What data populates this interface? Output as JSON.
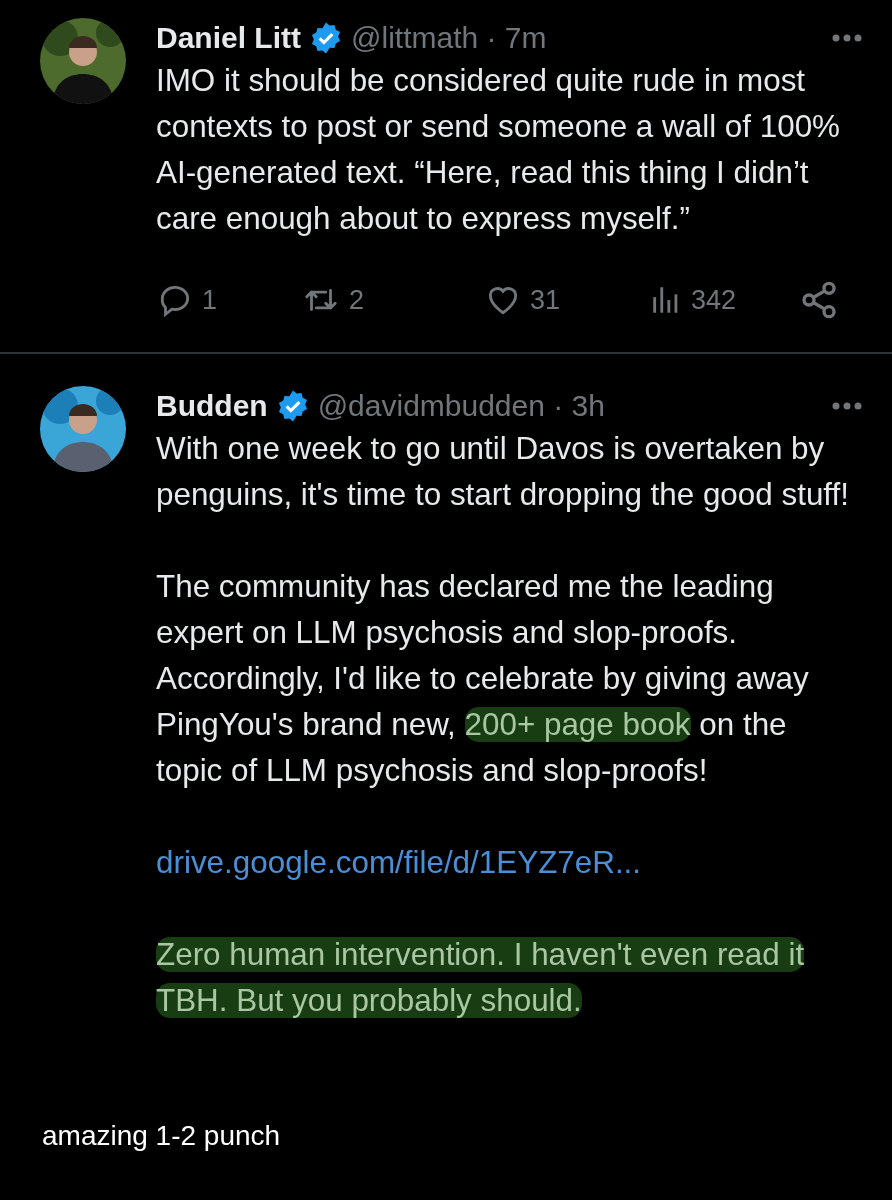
{
  "tweets": [
    {
      "author": "Daniel Litt",
      "verified": true,
      "meta": "@littmath · 7m",
      "body": [
        [
          {
            "kind": "text",
            "text": "IMO it should be considered quite rude in most contexts to post or send someone a wall of 100% AI-generated text. “Here, read this thing I didn’t care enough about to express myself.”"
          }
        ]
      ],
      "actions": [
        {
          "kind": "reply",
          "count": "1"
        },
        {
          "kind": "repost",
          "count": "2"
        },
        {
          "kind": "like",
          "count": "31"
        },
        {
          "kind": "views",
          "count": "342"
        },
        {
          "kind": "share"
        }
      ]
    },
    {
      "author": "Budden",
      "verified": true,
      "meta": "@davidmbudden · 3h",
      "body": [
        [
          {
            "kind": "text",
            "text": "With one week to go until Davos is overtaken by penguins, it's time to start dropping the good stuff!"
          }
        ],
        [
          {
            "kind": "text",
            "text": "The community has declared me the leading expert on LLM psychosis and slop-proofs. Accordingly, I'd like to celebrate by giving away PingYou's brand new, "
          },
          {
            "kind": "highlight",
            "text": "200+ page book"
          },
          {
            "kind": "text",
            "text": " on the topic of LLM psychosis and slop-proofs!"
          }
        ],
        [
          {
            "kind": "link",
            "text": "drive.google.com/file/d/1EYZ7eR..."
          }
        ],
        [
          {
            "kind": "highlight",
            "text": "Zero human intervention. I haven't even read it TBH. But you probably should."
          }
        ]
      ]
    }
  ],
  "caption": "amazing 1-2 punch"
}
